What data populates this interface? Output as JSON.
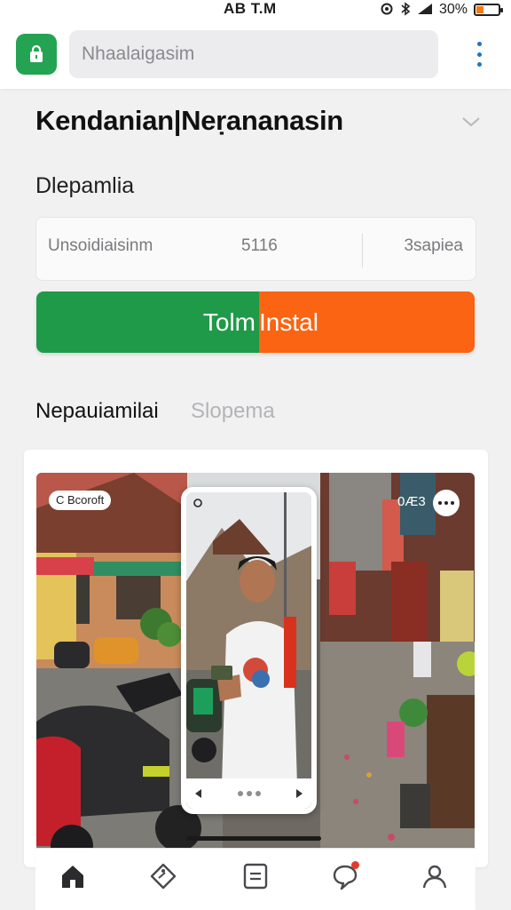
{
  "status_bar": {
    "time": "AB T.M",
    "battery_text": "30%",
    "battery_level": 0.3,
    "battery_color": "#f07a1a"
  },
  "header": {
    "app_icon": "shopping-bag-icon",
    "search_placeholder": "Nhaalaigasim",
    "menu_icon": "more-vertical-icon"
  },
  "app": {
    "title": "Kendanian|Neṛananasin",
    "section_title": "Dlepamlia",
    "info": {
      "name": "Unsoidiaisinm",
      "size": "5116",
      "right_label": "3sapiea"
    },
    "install_button": {
      "left_label": "Tolm",
      "right_label": "Instal",
      "left_color": "#1f9a48",
      "right_color": "#fa6412"
    }
  },
  "tabs": [
    {
      "label": "Nepauiamilai",
      "active": true
    },
    {
      "label": "Slopema",
      "active": false
    }
  ],
  "screenshot": {
    "chip_left": "C Bcoroft",
    "chip_right": "0Æ3"
  },
  "bottom_nav": [
    {
      "icon": "home-icon",
      "active": true
    },
    {
      "icon": "tag-icon",
      "active": false
    },
    {
      "icon": "list-icon",
      "active": false
    },
    {
      "icon": "chat-icon",
      "active": false,
      "badge": true
    },
    {
      "icon": "profile-icon",
      "active": false
    }
  ]
}
